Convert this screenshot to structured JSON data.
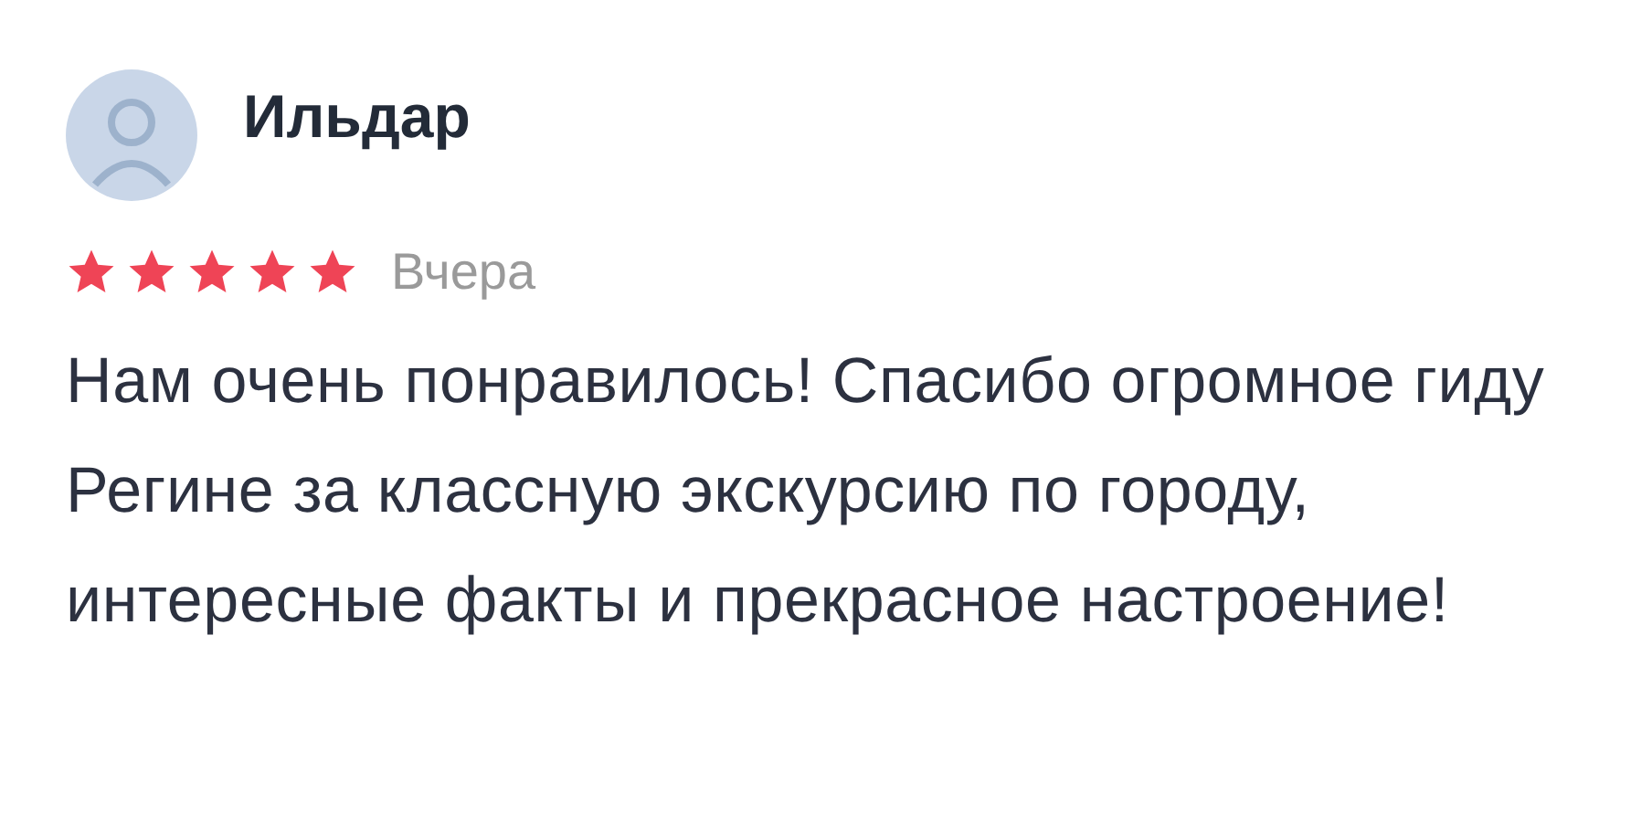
{
  "review": {
    "author": "Ильдар",
    "stars": 5,
    "date": "Вчера",
    "text": "Нам очень понравилось! Спасибо огромное гиду Регине за классную экскурсию по городу, интересные факты и прекрасное настроение!"
  }
}
